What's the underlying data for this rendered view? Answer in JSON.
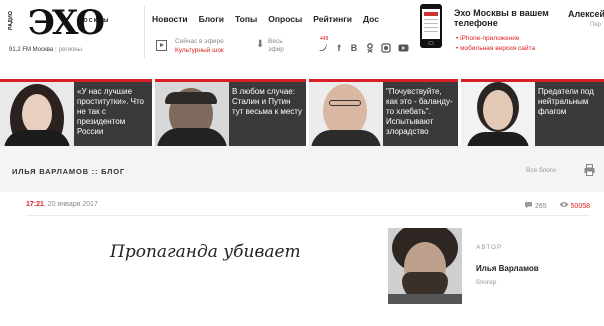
{
  "logo": {
    "radio": "РАДИО",
    "main": "ЭХО",
    "moskvy": "МОСКВЫ",
    "frequency": "91,2 FM Москва",
    "regions": "регионы"
  },
  "nav": {
    "items": [
      {
        "label": "Новости"
      },
      {
        "label": "Блоги"
      },
      {
        "label": "Топы"
      },
      {
        "label": "Опросы"
      },
      {
        "label": "Рейтинги"
      },
      {
        "label": "Дос"
      }
    ]
  },
  "live": {
    "label": "Сейчас в эфире",
    "show": "Культурный шок"
  },
  "air": {
    "label_line1": "Весь",
    "label_line2": "эфир"
  },
  "social": {
    "count": "448",
    "icons": [
      "twitter-icon",
      "facebook-icon",
      "vk-icon",
      "odnoklassniki-icon",
      "livejournal-icon",
      "youtube-icon"
    ]
  },
  "promo": {
    "title": "Эхо Москвы в вашем телефоне",
    "links": [
      "iPhone-приложение",
      "мобильная версия сайта"
    ]
  },
  "user": {
    "name": "Алексей",
    "sub": "Пер"
  },
  "featured": [
    {
      "text": "«У нас лучшие проститутки». Что не так с президентом России"
    },
    {
      "text": "В любом случае: Сталин и Путин тут весьма к месту"
    },
    {
      "text": "\"Почувствуйте, как это - баланду-то хлебать\". Испытывают злорадство"
    },
    {
      "text": "Предатели под нейтральным флагом"
    }
  ],
  "blog": {
    "title": "ИЛЬЯ ВАРЛАМОВ :: БЛОГ",
    "all_blogs": "Все блоги"
  },
  "post": {
    "time": "17:21",
    "date": "20 января 2017",
    "comments": "265",
    "views": "50058",
    "title": "Пропаганда убивает"
  },
  "author": {
    "label": "АВТОР",
    "name": "Илья Варламов",
    "role": "блогер"
  },
  "colors": {
    "accent": "#d81f26",
    "featured_bg": "#3a3a3a",
    "blog_header_bg": "#f4f4f4"
  }
}
